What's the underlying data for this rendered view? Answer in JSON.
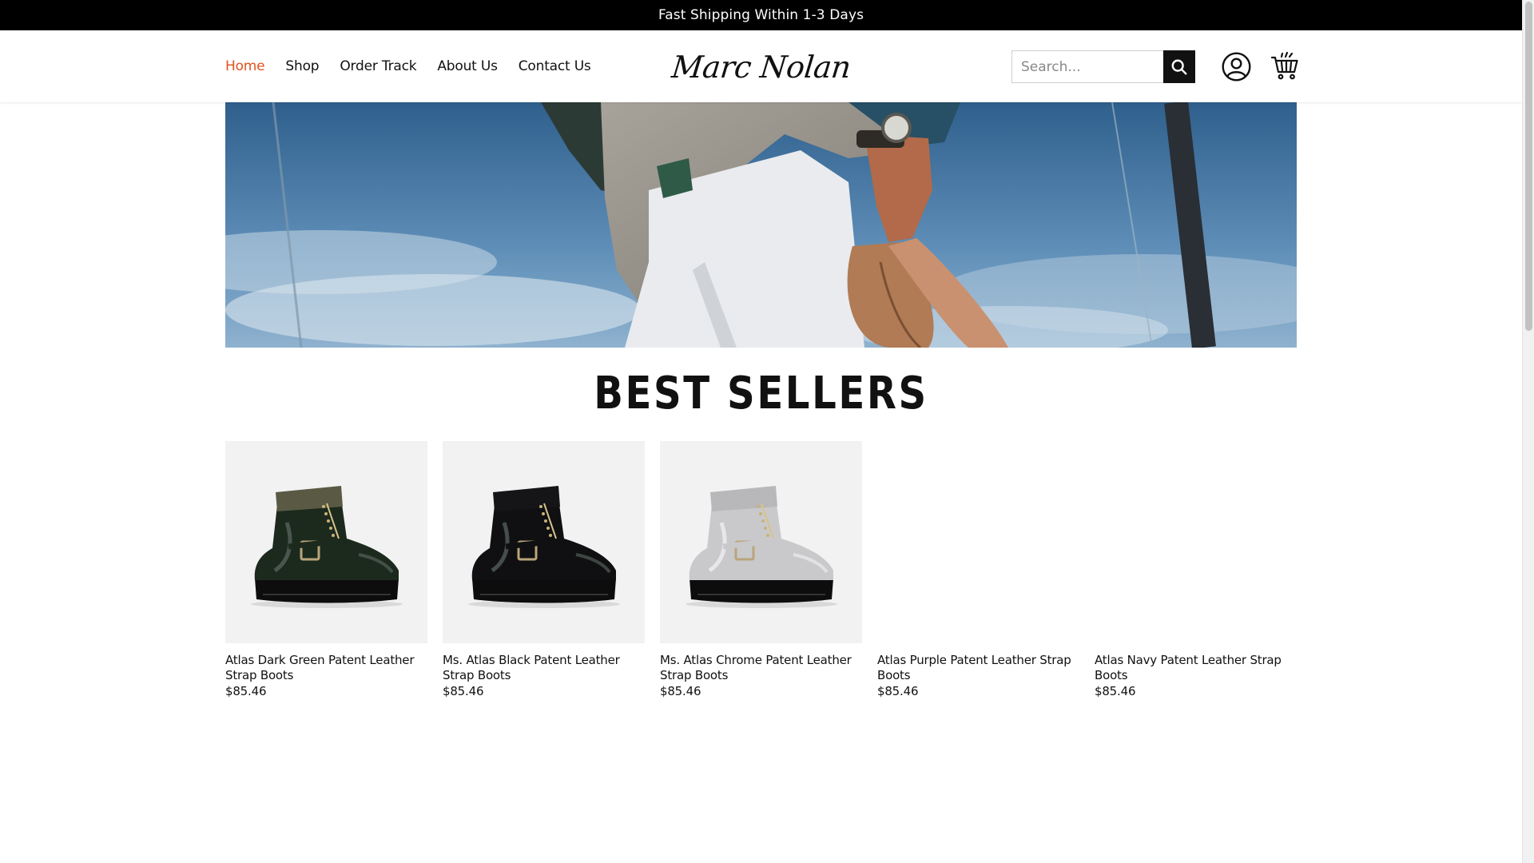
{
  "announcement": "Fast Shipping Within 1-3 Days",
  "nav": {
    "items": [
      {
        "label": "Home",
        "active": true
      },
      {
        "label": "Shop",
        "active": false
      },
      {
        "label": "Order Track",
        "active": false
      },
      {
        "label": "About Us",
        "active": false
      },
      {
        "label": "Contact Us",
        "active": false
      }
    ]
  },
  "brand": {
    "logo_text": "Marc Nolan"
  },
  "search": {
    "placeholder": "Search..."
  },
  "icons": {
    "search": "search-icon",
    "account": "user-circle-icon",
    "cart": "shopping-cart-icon"
  },
  "colors": {
    "accent": "#e0531f",
    "topbar": "#000000"
  },
  "section": {
    "title": "BEST SELLERS"
  },
  "products": [
    {
      "name": "Atlas Dark Green Patent Leather Strap Boots",
      "price": "$85.46",
      "boot_color": "#1c2a1e",
      "collar_color": "#5a5a44"
    },
    {
      "name": "Ms. Atlas Black Patent Leather Strap Boots",
      "price": "$85.46",
      "boot_color": "#101012",
      "collar_color": "#151518"
    },
    {
      "name": "Ms. Atlas Chrome Patent Leather Strap Boots",
      "price": "$85.46",
      "boot_color": "#c9c9cc",
      "collar_color": "#b8b8ba"
    },
    {
      "name": "Atlas Purple Patent Leather Strap Boots",
      "price": "$85.46"
    },
    {
      "name": "Atlas Navy Patent Leather Strap Boots",
      "price": "$85.46"
    }
  ]
}
